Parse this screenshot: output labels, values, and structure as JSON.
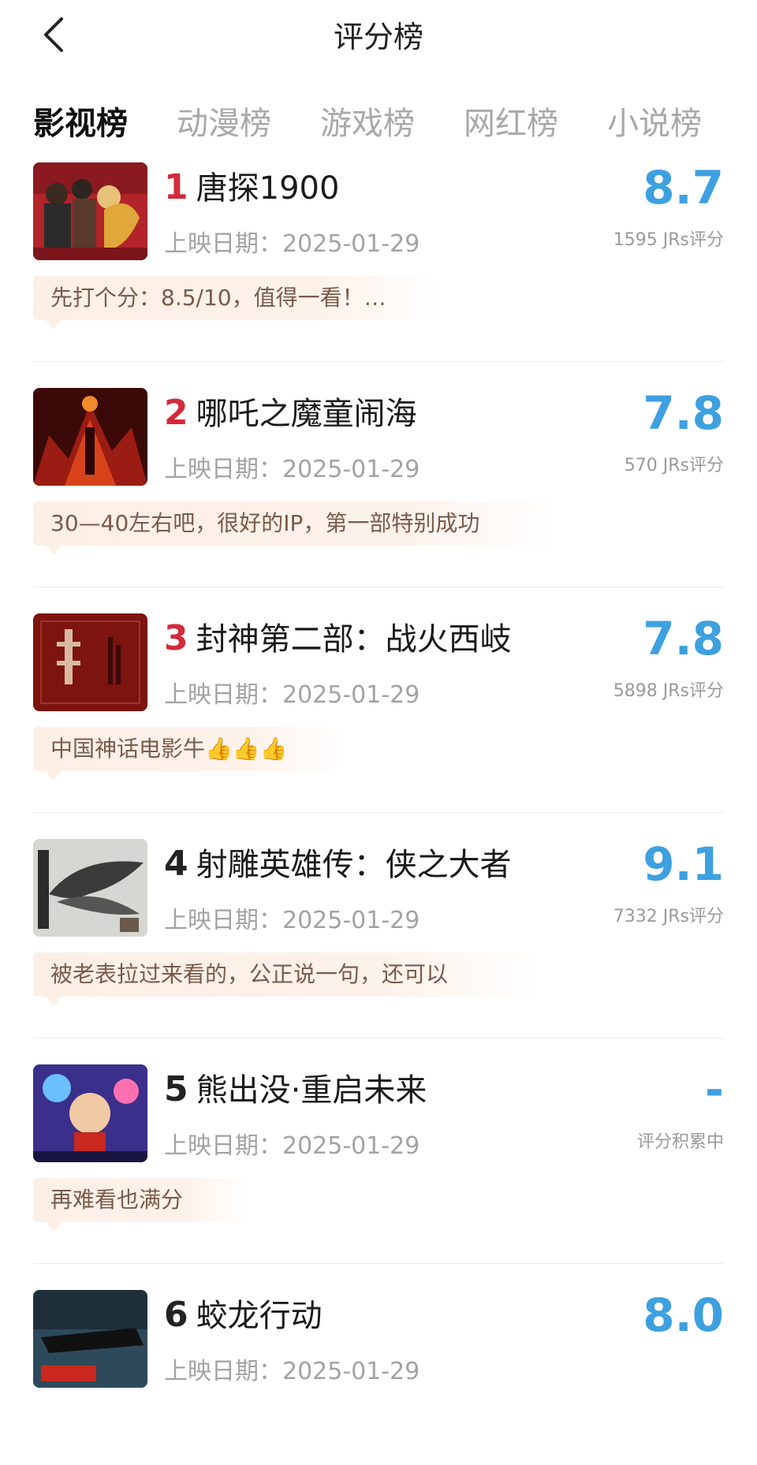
{
  "header": {
    "title": "评分榜"
  },
  "tabs": [
    {
      "label": "影视榜",
      "active": true
    },
    {
      "label": "动漫榜",
      "active": false
    },
    {
      "label": "游戏榜",
      "active": false
    },
    {
      "label": "网红榜",
      "active": false
    },
    {
      "label": "小说榜",
      "active": false
    }
  ],
  "release_label": "上映日期：",
  "items": [
    {
      "rank": "1",
      "title": "唐探1900",
      "release_date": "2025-01-29",
      "score": "8.7",
      "score_count": "1595 JRs评分",
      "comment": "先打个分：8.5/10，值得一看！…",
      "rank_color": "red"
    },
    {
      "rank": "2",
      "title": "哪吒之魔童闹海",
      "release_date": "2025-01-29",
      "score": "7.8",
      "score_count": "570 JRs评分",
      "comment": "30—40左右吧，很好的IP，第一部特别成功",
      "rank_color": "red"
    },
    {
      "rank": "3",
      "title": "封神第二部：战火西岐",
      "release_date": "2025-01-29",
      "score": "7.8",
      "score_count": "5898 JRs评分",
      "comment": "中国神话电影牛👍👍👍",
      "rank_color": "red"
    },
    {
      "rank": "4",
      "title": "射雕英雄传：侠之大者",
      "release_date": "2025-01-29",
      "score": "9.1",
      "score_count": "7332 JRs评分",
      "comment": "被老表拉过来看的，公正说一句，还可以",
      "rank_color": "dark"
    },
    {
      "rank": "5",
      "title": "熊出没·重启未来",
      "release_date": "2025-01-29",
      "score": "-",
      "score_count": "评分积累中",
      "comment": "再难看也满分",
      "rank_color": "dark"
    },
    {
      "rank": "6",
      "title": "蛟龙行动",
      "release_date": "2025-01-29",
      "score": "8.0",
      "score_count": "",
      "comment": "",
      "rank_color": "dark"
    }
  ],
  "colors": {
    "accent_score": "#3da0e0",
    "rank_red": "#d42a3a",
    "comment_bg": "#fcefe6",
    "comment_text": "#7b5a4a"
  }
}
